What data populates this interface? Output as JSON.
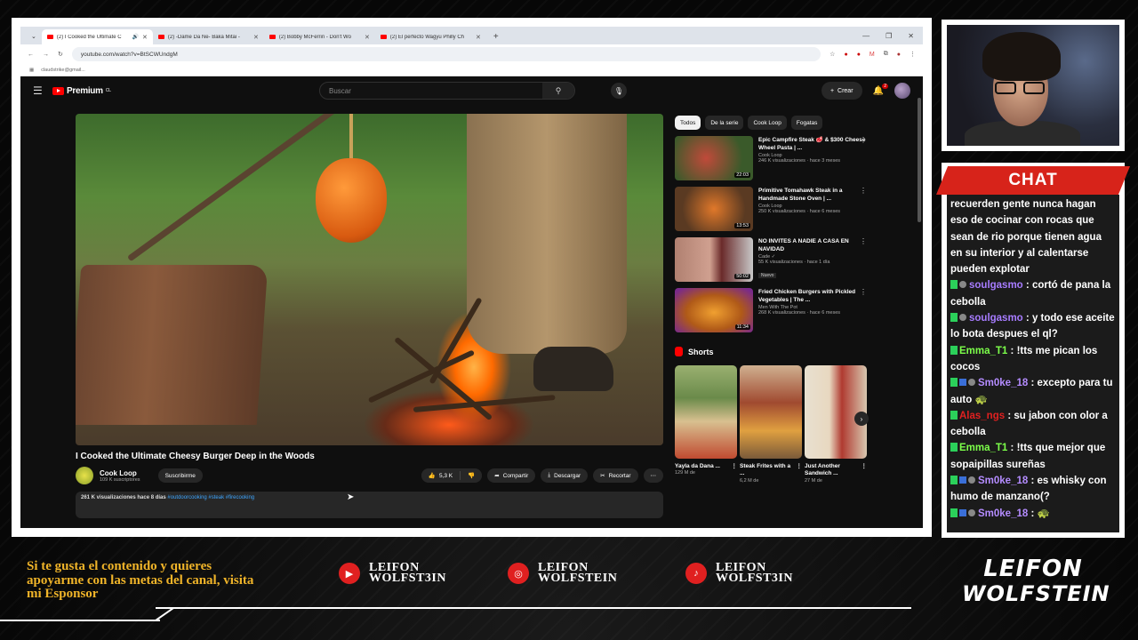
{
  "browser": {
    "tabs": [
      {
        "title": "(2) I Cooked the Ultimate C",
        "active": true
      },
      {
        "title": "(2) -Dame Da Ne- Baka Mitai -",
        "active": false
      },
      {
        "title": "(2) Bobby McFerrin - Don't Wo",
        "active": false
      },
      {
        "title": "(2) El perfecto Wagyu Philly Ch",
        "active": false
      }
    ],
    "url": "youtube.com/watch?v=BtSCWUndgM",
    "bookmark": "claudstrike@gmail..."
  },
  "youtube": {
    "logo_text": "Premium",
    "logo_region": "CL",
    "search_placeholder": "Buscar",
    "create_label": "Crear",
    "notif_count": "2"
  },
  "video": {
    "title": "I Cooked the Ultimate Cheesy Burger Deep in the Woods",
    "channel": "Cook Loop",
    "subscribers": "109 K suscriptores",
    "subscribe_label": "Suscribirme",
    "likes": "5,3 K",
    "share_label": "Compartir",
    "download_label": "Descargar",
    "clip_label": "Recortar",
    "views_date": "261 K visualizaciones  hace 8 días",
    "tags": "#outdoorcooking #steak #firecooking"
  },
  "sidebar": {
    "chips": [
      "Todos",
      "De la serie",
      "Cook Loop",
      "Fogatas"
    ],
    "recommendations": [
      {
        "title": "Epic Campfire Steak 🥩 & $300 Cheese Wheel Pasta | ...",
        "channel": "Cook Loop",
        "meta": "246 K visualizaciones · hace 3 meses",
        "duration": "22:03",
        "badge": ""
      },
      {
        "title": "Primitive Tomahawk Steak in a Handmade Stone Oven | ...",
        "channel": "Cook Loop",
        "meta": "250 K visualizaciones · hace 6 meses",
        "duration": "13:53",
        "badge": ""
      },
      {
        "title": "NO INVITES A NADIE A CASA EN NAVIDAD",
        "channel": "Cade ✓",
        "meta": "55 K visualizaciones · hace 1 día",
        "duration": "50:02",
        "badge": "Nuevo"
      },
      {
        "title": "Fried Chicken Burgers with Pickled Vegetables | The ...",
        "channel": "Men With The Pot",
        "meta": "268 K visualizaciones · hace 6 meses",
        "duration": "11:34",
        "badge": ""
      }
    ],
    "shorts_label": "Shorts",
    "shorts": [
      {
        "title": "Yayla da Dana ...",
        "views": "129 M de"
      },
      {
        "title": "Steak Frites with a ...",
        "views": "6,2 M de"
      },
      {
        "title": "Just Another Sandwich ...",
        "views": "27 M de"
      }
    ]
  },
  "chat": {
    "title": "CHAT",
    "messages": [
      {
        "user": "",
        "user_color": "#ffffff",
        "text": "recuerden gente nunca hagan eso de cocinar con rocas que sean de rio porque tienen agua en su interior y al calentarse pueden explotar",
        "badges": ""
      },
      {
        "user": "soulgasmo",
        "user_color": "#a77cff",
        "text": ": cortó de pana la cebolla",
        "badges": "gg"
      },
      {
        "user": "soulgasmo",
        "user_color": "#a77cff",
        "text": ": y todo ese aceite lo bota despues el ql?",
        "badges": "gg"
      },
      {
        "user": "Emma_T1",
        "user_color": "#7cff4a",
        "text": ": !tts me pican los cocos",
        "badges": "g"
      },
      {
        "user": "Sm0ke_18",
        "user_color": "#b48cff",
        "text": ": excepto para tu auto 🐢",
        "badges": "gbg"
      },
      {
        "user": "Alas_ngs",
        "user_color": "#e02020",
        "text": ": su jabon con olor a cebolla",
        "badges": "g"
      },
      {
        "user": "Emma_T1",
        "user_color": "#7cff4a",
        "text": ": !tts que mejor que sopaipillas sureñas",
        "badges": "g"
      },
      {
        "user": "Sm0ke_18",
        "user_color": "#b48cff",
        "text": ": es whisky con humo de manzano(?",
        "badges": "gbg"
      },
      {
        "user": "Sm0ke_18",
        "user_color": "#b48cff",
        "text": ": 🐢",
        "badges": "gbg"
      }
    ]
  },
  "footer": {
    "sponsor_text": "Si te gusta el contenido y quieres apoyarme con las metas del canal, visita mi Esponsor",
    "socials": [
      {
        "icon": "youtube-icon",
        "line1": "LEIFON",
        "line2": "WOLFST3IN"
      },
      {
        "icon": "instagram-icon",
        "line1": "LEIFON",
        "line2": "WOLFSTEIN"
      },
      {
        "icon": "tiktok-icon",
        "line1": "LEIFON",
        "line2": "WOLFST3IN"
      }
    ],
    "brand_line1": "LEIFON",
    "brand_line2": "WOLFSTEIN"
  },
  "colors": {
    "accent_red": "#e02020",
    "chat_header": "#d7231a",
    "sponsor_text": "#f0b429"
  }
}
